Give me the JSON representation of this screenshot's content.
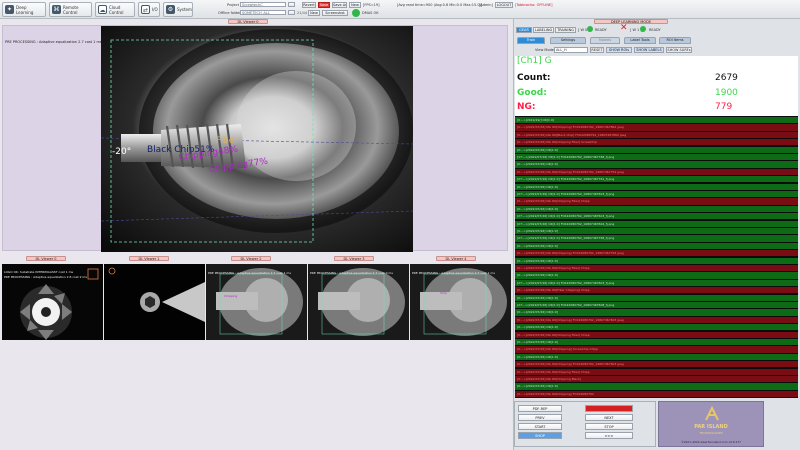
{
  "toolbar": {
    "deep_learning": "Deep Learning",
    "remote_control": "Remote Control",
    "cloud_control": "Cloud Control",
    "io": "I/O",
    "system": "System",
    "project_label": "Project",
    "project_value": "ScrewtechC",
    "offline_label": "Offline folder",
    "offline_value": "SOMETECH_ALL",
    "counter": "21/44",
    "revert": "Revert",
    "save": "Save",
    "save_as": "Save As",
    "new_top": "New",
    "new_bottom": "New",
    "screenshot": "Screenshot",
    "dmas": "DMAS OK",
    "fps": "[FPS=19]",
    "avg": "[Avg read time=900 (Avg:0.6 Min:0.0 Max:15.0)]",
    "admin": "[Admin]",
    "logout": "LOGOUT",
    "status": "[Tobbrocho: OFFLINE]"
  },
  "main_viewer": {
    "tab": "DL Viewer 0",
    "preproc": "PRE PROCESSING : Adaptive equalization 2.7 cost 1 ms",
    "ann_angle": "-20°",
    "ann_fiber": "Fiber",
    "ann_black": "Black Chip51%",
    "ann_chip1": "Chipping48%",
    "ann_chip2": "Chipping77%"
  },
  "thumbs": [
    {
      "tab": "DL Viewer 0",
      "text1": "LOGO OK: Substrate INTERIMAASST cost 1 ms",
      "text2": "PRE PROCESSING : Adaptive equalization 2.8 cost 2 ms"
    },
    {
      "tab": "DL Viewer 1",
      "text1": "",
      "text2": ""
    },
    {
      "tab": "DL Viewer 2",
      "text1": "PRE PROCESSING : Adaptive equalization 2.7 cost 1 ms",
      "text2": ""
    },
    {
      "tab": "DL Viewer 3",
      "text1": "PRE PROCESSING : Adaptive equalization 2.7 cost 0 ms",
      "text2": ""
    },
    {
      "tab": "DL Viewer 4",
      "text1": "PRE PROCESSING : Adaptive equalization 2.7 cost 1 ms",
      "text2": ""
    }
  ],
  "right": {
    "mode": "DEEP LEARNING MODE",
    "tab_gear": "GEAR",
    "tab_labeling": "LABELING",
    "tab_training": "TRAINING",
    "w1": "[ W 0 ]",
    "ready1": "READY",
    "w2": "[ W 1 ]",
    "ready2": "READY",
    "sub_train": "Train",
    "sub_settings": "Settings",
    "sub_models": "Models",
    "sub_label_tools": "Label Tools",
    "sub_roi": "ROI Items",
    "view_mode_label": "View Mode",
    "view_mode_value": "ALL_H",
    "reset": "RESET",
    "show_rois": "SHOW ROIs",
    "show_labels": "SHOW LABELS",
    "show_surf": "SHOW SURFs",
    "channel": "[Ch1] G",
    "count_label": "Count:",
    "count_value": "2679",
    "good_label": "Good:",
    "good_value": "1900",
    "ng_label": "NG:",
    "ng_value": "779"
  },
  "logs": [
    {
      "t": "ok",
      "text": "[0:-->[2019/19/] OK[1:0]"
    },
    {
      "t": "ng",
      "text": "[0:-->[2022/07/26] NG OK[Chipping] FCK22080762_19807467862 jpeg"
    },
    {
      "t": "ng",
      "text": "[0:-->[2022/07/26] NG OK[Black Chip] FCK22080762_19807467860 jpeg"
    },
    {
      "t": "ng",
      "text": "[0:-->[2022/07/26] NG OK[Chipping Fiber] ScrewChip"
    },
    {
      "t": "ok",
      "text": "[0:-->[2022/07/26] OK[1:0]"
    },
    {
      "t": "ok",
      "text": "[17:-->[2022/07/26] OK[1:0] FCK22080762_19807467768_fj.png"
    },
    {
      "t": "ok",
      "text": "[0:-->[2022/07/26] OK[1:0]"
    },
    {
      "t": "ng",
      "text": "[0:-->[2022/07/26] NG OK[Chipping] FCK22080762_19807467754 jpeg"
    },
    {
      "t": "ok",
      "text": "[27:-->[2022/07/26] OK[1:0] FCK22080762_19807467761_fj.png"
    },
    {
      "t": "ok",
      "text": "[0:-->[2022/07/26] OK[1:0]"
    },
    {
      "t": "ok",
      "text": "[27:-->[2022/07/26] OK[1:0] FCK22080762_19807467603_fj.png"
    },
    {
      "t": "ng",
      "text": "[0:-->[2022/07/26] NG OK[Chipping Fiber] Chipp"
    },
    {
      "t": "ok",
      "text": "[0:-->[2022/07/26] OK[1:0]"
    },
    {
      "t": "ok",
      "text": "[27:-->[2022/07/26] OK[1:0] FCK22080762_19807467603_fj.png"
    },
    {
      "t": "ok",
      "text": "[27:-->[2022/07/26] OK[1:0] FCK22080762_19807467604_fj.png"
    },
    {
      "t": "ok",
      "text": "[0:-->[2022/07/26] OK[1:0]"
    },
    {
      "t": "ok",
      "text": "[27:-->[2022/07/26] OK[1:0] FCK22080762_19807467768_fj.png"
    },
    {
      "t": "ok",
      "text": "[0:-->[2022/07/26] OK[1:0]"
    },
    {
      "t": "ng",
      "text": "[0:-->[2022/07/26] NG OK[Chipping] FCK22080762_19807467763 jpeg"
    },
    {
      "t": "ok",
      "text": "[0:-->[2022/07/26] OK[1:0]"
    },
    {
      "t": "ng",
      "text": "[0:-->[2022/07/26] NG OK[Chipping Fiber] Chipp"
    },
    {
      "t": "ok",
      "text": "[0:-->[2022/07/26] OK[1:0]"
    },
    {
      "t": "ok",
      "text": "[27:-->[2022/07/26] OK[1:0] FCK22080762_19807467603_fj.png"
    },
    {
      "t": "ng",
      "text": "[0:-->[2022/07/26] NG OK[Fiber Chipping] Chipp"
    },
    {
      "t": "ok",
      "text": "[0:-->[2022/07/26] OK[1:0]"
    },
    {
      "t": "ok",
      "text": "[27:-->[2022/07/26] OK[1:0] FCK22080762_19807467608_fj.png"
    },
    {
      "t": "ok",
      "text": "[0:-->[2022/07/26] OK[1:0]"
    },
    {
      "t": "ng",
      "text": "[0:-->[2022/07/26] NG OK[Chipping] FCK22080762_19807467603 jpeg"
    },
    {
      "t": "ok",
      "text": "[0:-->[2022/07/26] OK[1:0]"
    },
    {
      "t": "ng",
      "text": "[0:-->[2022/07/26] NG OK[Chipping Fiber] Chipp"
    },
    {
      "t": "ok",
      "text": "[0:-->[2022/07/26] OK[1:0]"
    },
    {
      "t": "ng",
      "text": "[0:-->[2022/07/26] NG OK[Chipping] ScrewChip Chipp"
    },
    {
      "t": "ok",
      "text": "[0:-->[2022/07/26] OK[1:0]"
    },
    {
      "t": "ng",
      "text": "[0:-->[2022/07/26] NG OK[Chipping] FCK22080762_19807467603 jpeg"
    },
    {
      "t": "ng",
      "text": "[0:-->[2022/07/26] NG OK[Chipping Fiber] Chipp"
    },
    {
      "t": "ng",
      "text": "[0:-->[2022/07/26] NG OK[Chipping Black]"
    },
    {
      "t": "ok",
      "text": "[0:-->[2022/07/26] OK[1:0]"
    },
    {
      "t": "ng",
      "text": "[0:-->[2022/07/26] NG OK[Chipping] FCK22080762"
    }
  ],
  "controls": {
    "pdf_rep": "PDF-REP",
    "prev": "PREV",
    "start": "START",
    "shop": "SHOP",
    "next": "NEXT",
    "stop": "STOP",
    "more": ">>>"
  },
  "logo": {
    "brand": "PAR ISLAND",
    "tagline": "TECHNOLOGIES",
    "copyright": "©2021–2024 www.far-island.com  v2.8.177"
  },
  "colors": {
    "accent": "#2e8bd6",
    "good": "#39d84a",
    "ng": "#ff1e44",
    "ng_row": "#7a0c14",
    "ok_row": "#0e6b15"
  }
}
